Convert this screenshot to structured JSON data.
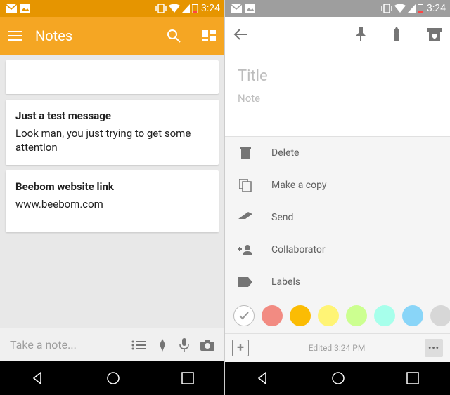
{
  "status": {
    "time": "3:24"
  },
  "left": {
    "title": "Notes",
    "cards": [
      {
        "title": "Just a test message",
        "body": "Look man, you just trying to get some attention"
      },
      {
        "title": "Beebom website link",
        "body": "www.beebom.com"
      }
    ],
    "input_placeholder": "Take a note..."
  },
  "right": {
    "title_placeholder": "Title",
    "note_placeholder": "Note",
    "menu": [
      {
        "label": "Delete"
      },
      {
        "label": "Make a copy"
      },
      {
        "label": "Send"
      },
      {
        "label": "Collaborator"
      },
      {
        "label": "Labels"
      }
    ],
    "colors": [
      "#ffffff",
      "#f28b82",
      "#fbbc04",
      "#fff475",
      "#ccff90",
      "#a7ffeb",
      "#89d5f8",
      "#d7d7d7"
    ],
    "edited": "Edited 3:24 PM"
  }
}
